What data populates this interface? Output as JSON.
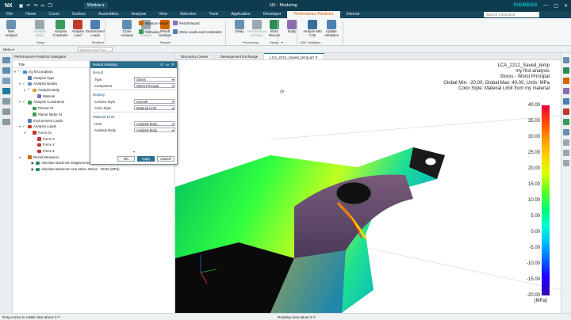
{
  "titlebar": {
    "logo": "NX",
    "window_menu": "Window ▾",
    "title": "NX - Modeling",
    "brand": "SIEMENS",
    "min": "—",
    "max": "▢",
    "close": "✕"
  },
  "menubar": {
    "tabs": [
      "File",
      "Home",
      "Curve",
      "Surface",
      "Assemblies",
      "Analysis",
      "View",
      "Selection",
      "Tools",
      "Application",
      "Developer",
      "Performance Predictor",
      "Internal"
    ],
    "active_tab": "Performance Predictor",
    "search_placeholder": "Search Command"
  },
  "ribbon": {
    "buttons": [
      {
        "label": "New Analysis",
        "color": "#6a8fb0",
        "disabled": false
      },
      {
        "label": "Analysis Study",
        "color": "#9aa7ae",
        "disabled": true
      },
      {
        "label": "Analysis Constraint",
        "color": "#3c9a5a",
        "disabled": false
      },
      {
        "label": "Analysis Load",
        "color": "#c0392b",
        "disabled": false
      },
      {
        "label": "Environment Loads",
        "color": "#4e7fb5",
        "disabled": false
      },
      {
        "label": "Clone Analysis",
        "color": "#5b8db0",
        "disabled": false
      },
      {
        "label": "Delete Analysis",
        "color": "#9aa7ae",
        "disabled": true
      },
      {
        "label": "Result Settings",
        "color": "#d26400",
        "disabled": false
      },
      {
        "label": "Delay",
        "color": "#6a8fb0",
        "disabled": false
      },
      {
        "label": "Performance Settings",
        "color": "#9aa7ae",
        "disabled": true
      },
      {
        "label": "Show Results",
        "color": "#2e8b57",
        "disabled": false
      },
      {
        "label": "Study",
        "color": "#8a6fb0",
        "disabled": false
      },
      {
        "label": "Analyze with CAE",
        "color": "#3b6f9b",
        "disabled": false
      },
      {
        "label": "Update Attributes",
        "color": "#4e7fb5",
        "disabled": false
      }
    ],
    "small": [
      "Measure Result",
      "Animation",
      "Result Report",
      "Show Loads and Constraints"
    ],
    "groups": [
      "Setup",
      "Modify ▾",
      "Results",
      "Processing",
      "Desig... ▾",
      "CAE Validation"
    ]
  },
  "toolbar2": {
    "menu": "Menu ▾",
    "filter": "Without Work Part Only"
  },
  "navigator": {
    "header": "Performance Predictor Navigator",
    "column": "Title",
    "tree": [
      {
        "label": "my first analysis",
        "depth": 0,
        "twisty": "▾",
        "check": true,
        "color": "#3b8ed0"
      },
      {
        "label": "Analysis Type",
        "depth": 1,
        "twisty": "",
        "check": false,
        "color": "#5a7fa0"
      },
      {
        "label": "Analysis Bodies",
        "depth": 1,
        "twisty": "▾",
        "check": true,
        "color": "#6a8fb0"
      },
      {
        "label": "Analysis Body",
        "depth": 2,
        "twisty": "▸",
        "check": true,
        "color": "#e0a040"
      },
      {
        "label": "Material",
        "depth": 3,
        "twisty": "",
        "check": false,
        "color": "#7d6fb0"
      },
      {
        "label": "Analysis Constraints",
        "depth": 1,
        "twisty": "▾",
        "check": true,
        "color": "#3c9a5a"
      },
      {
        "label": "Pinned 01",
        "depth": 2,
        "twisty": "",
        "check": false,
        "color": "#3c9a5a"
      },
      {
        "label": "Planar Slider 01",
        "depth": 2,
        "twisty": "",
        "check": false,
        "color": "#3c9a5a"
      },
      {
        "label": "Environment Loads",
        "depth": 1,
        "twisty": "",
        "check": false,
        "color": "#4e7fb5"
      },
      {
        "label": "Analysis Loads",
        "depth": 1,
        "twisty": "▾",
        "check": true,
        "color": "#c0392b"
      },
      {
        "label": "Force 01",
        "depth": 2,
        "twisty": "▾",
        "check": false,
        "color": "#c0392b"
      },
      {
        "label": "Force X",
        "depth": 3,
        "twisty": "",
        "check": false,
        "color": "#c0392b"
      },
      {
        "label": "Force Y",
        "depth": 3,
        "twisty": "",
        "check": false,
        "color": "#c0392b"
      },
      {
        "label": "Force Z",
        "depth": 3,
        "twisty": "",
        "check": false,
        "color": "#c0392b"
      },
      {
        "label": "Result Measures",
        "depth": 1,
        "twisty": "▾",
        "check": false,
        "color": "#d26400"
      },
      {
        "label": "Absolute Maximum Displacement",
        "depth": 2,
        "twisty": "",
        "check": false,
        "color": "#2e8b57",
        "eye": true
      },
      {
        "label": "Absolute Maximum Von Mises Stress",
        "depth": 2,
        "twisty": "",
        "check": false,
        "color": "#2e8b57",
        "eye": true,
        "value": "99.90 (MPa)"
      }
    ]
  },
  "tabs": [
    "Discovery Center",
    "Development Exchange",
    "LCA_2212_Saved_temp.prt ✕"
  ],
  "overlay_lines": [
    "LCA_2212_Saved_temp",
    "my first analysis",
    "Stress - Worst Principal",
    "Global Min: -20.00, Global Max: 40.00, Units: MPa",
    "Color Style: Material Limit from my material"
  ],
  "legend": {
    "ticks": [
      "40.00",
      "35.00",
      "30.00",
      "25.00",
      "20.00",
      "15.00",
      "10.00",
      "5.00",
      "0.00",
      "-5.00",
      "-10.00",
      "-15.00",
      "-20.00"
    ],
    "unit": "[MPa]"
  },
  "dialog": {
    "title": "Result Settings",
    "sections": {
      "result": "Result",
      "display": "Display",
      "material": "Material Limit"
    },
    "rows": {
      "type_label": "Type",
      "type_value": "Stress",
      "component_label": "Component",
      "component_value": "Worst Principal",
      "contour_label": "Contour Style",
      "contour_value": "Smooth",
      "color_label": "Color Style",
      "color_value": "Material Limit",
      "limit_label": "Limit",
      "limit_value": "Analysis Body",
      "body_label": "Analysis Body",
      "body_value": "Analysis Body"
    },
    "more": "▾",
    "ok": "OK",
    "apply": "Apply",
    "cancel": "Cancel"
  },
  "status": {
    "left": "Drag cursor to rotate view about X-Y",
    "center": "Rotating view about X-Y"
  }
}
